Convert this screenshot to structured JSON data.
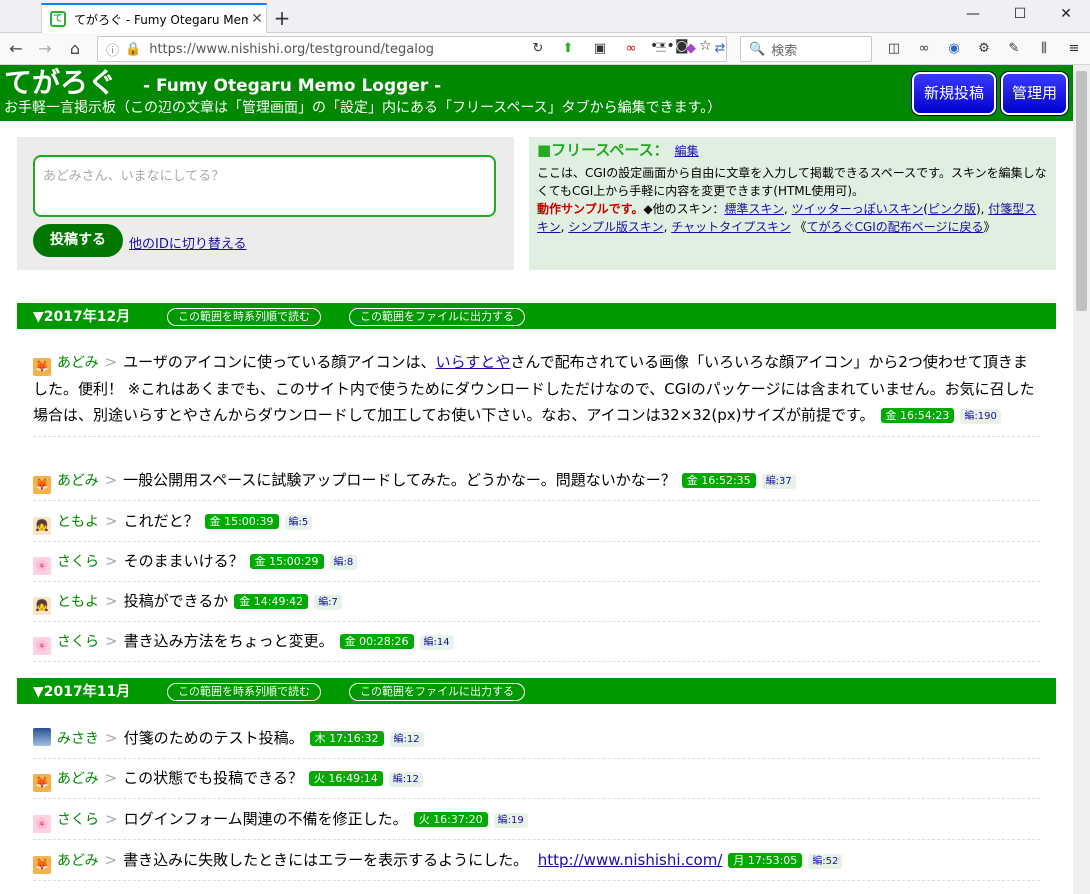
{
  "browser": {
    "tab_title": "てがろぐ - Fumy Otegaru Memo",
    "tab_favicon": "て",
    "url": "https://www.nishishi.org/testground/tegalog",
    "url_overflow": "•••",
    "search_placeholder": "検索",
    "window_controls": {
      "minimize": "—",
      "maximize": "☐",
      "close": "✕"
    }
  },
  "header": {
    "logo": "てがろぐ",
    "subtitle": "- Fumy Otegaru Memo Logger -",
    "description": "お手軽一言掲示板（この辺の文章は「管理画面」の「設定」内にある「フリースペース」タブから編集できます。）",
    "new_post_button": "新規投稿",
    "admin_button": "管理用",
    "bg_color": "#008800"
  },
  "compose": {
    "placeholder": "あどみさん、いまなにしてる？",
    "submit_label": "投稿する",
    "switch_id_link": "他のIDに切り替える"
  },
  "free_space": {
    "title": "■フリースペース：",
    "edit_link": "編集",
    "text1": "ここは、CGIの設定画面から自由に文章を入力して掲載できるスペースです。スキンを編集しなくてもCGI上から手軽に内容を変更できます(HTML使用可)。",
    "sample_label": "動作サンプルです。",
    "other_skins_label": "◆他のスキン：",
    "skins": [
      "標準スキン",
      "ツイッターっぽいスキン",
      "ピンク版",
      "付箋型スキン",
      "シンプル版スキン",
      "チャットタイプスキン"
    ],
    "back_link": "てがろぐCGIの配布ページに戻る"
  },
  "months": [
    {
      "title": "▼2017年12月",
      "read_chrono": "この範囲を時系列順で読む",
      "export_file": "この範囲をファイルに出力する",
      "posts": [
        {
          "avatar": "fox",
          "name": "あどみ",
          "text_before": "ユーザのアイコンに使っている顔アイコンは、",
          "link": "いらすとや",
          "text_after": "さんで配布されている画像「いろいろな顔アイコン」から2つ使わせて頂きました。便利！ ※これはあくまでも、このサイト内で使うためにダウンロードしただけなので、CGIのパッケージには含まれていません。お気に召した場合は、別途いらすとやさんからダウンロードして加工してお使い下さい。なお、アイコンは32×32(px)サイズが前提です。",
          "time": "金 16:54:23",
          "edit": "編:190"
        },
        {
          "avatar": "fox",
          "name": "あどみ",
          "text": "一般公開用スペースに試験アップロードしてみた。どうかなー。問題ないかなー？",
          "time": "金 16:52:35",
          "edit": "編:37"
        },
        {
          "avatar": "girl",
          "name": "ともよ",
          "text": "これだと？",
          "time": "金 15:00:39",
          "edit": "編:5"
        },
        {
          "avatar": "flower",
          "name": "さくら",
          "text": "そのままいける？",
          "time": "金 15:00:29",
          "edit": "編:8"
        },
        {
          "avatar": "girl",
          "name": "ともよ",
          "text": "投稿ができるか",
          "time": "金 14:49:42",
          "edit": "編:7"
        },
        {
          "avatar": "flower",
          "name": "さくら",
          "text": "書き込み方法をちょっと変更。",
          "time": "金 00:28:26",
          "edit": "編:14"
        }
      ]
    },
    {
      "title": "▼2017年11月",
      "read_chrono": "この範囲を時系列順で読む",
      "export_file": "この範囲をファイルに出力する",
      "posts": [
        {
          "avatar": "mountain",
          "name": "みさき",
          "text": "付箋のためのテスト投稿。",
          "time": "木 17:16:32",
          "edit": "編:12"
        },
        {
          "avatar": "fox",
          "name": "あどみ",
          "text": "この状態でも投稿できる？",
          "time": "火 16:49:14",
          "edit": "編:12"
        },
        {
          "avatar": "flower",
          "name": "さくら",
          "text": "ログインフォーム関連の不備を修正した。",
          "time": "火 16:37:20",
          "edit": "編:19"
        },
        {
          "avatar": "fox",
          "name": "あどみ",
          "text": "書き込みに失敗したときにはエラーを表示するようにした。",
          "url": "http://www.nishishi.com/",
          "time": "月 17:53:05",
          "edit": "編:52"
        }
      ]
    }
  ]
}
